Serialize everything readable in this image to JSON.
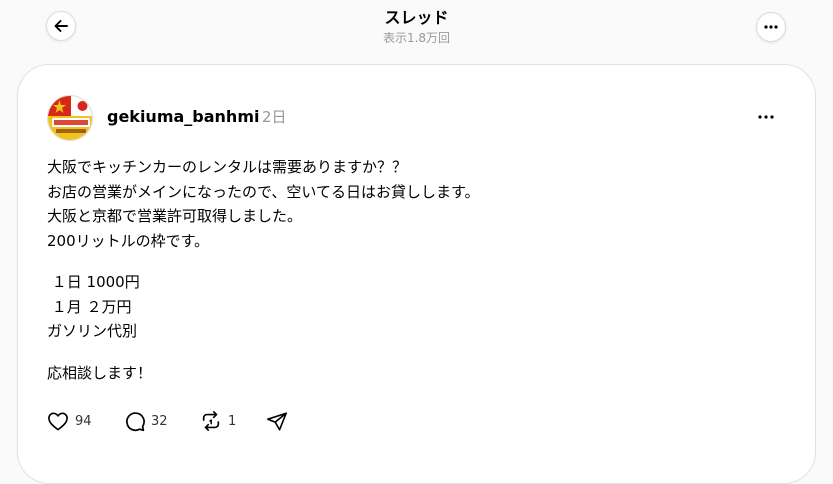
{
  "header": {
    "title": "スレッド",
    "views": "表示1.8万回"
  },
  "post": {
    "username": "gekiuma_banhmi",
    "time": "2日",
    "lines": [
      "大阪でキッチンカーのレンタルは需要ありますか？？",
      "お店の営業がメインになったので、空いてる日はお貸しします。",
      "大阪と京都で営業許可取得しました。",
      "200リットルの枠です。",
      "",
      " １日 1000円",
      " １月 ２万円",
      "ガソリン代別",
      "",
      "応相談します！"
    ],
    "likes": "94",
    "replies": "32",
    "reposts": "1"
  },
  "colors": {
    "background": "#fafafa",
    "card": "#ffffff",
    "muted": "#999999",
    "avatar_red": "#d62718",
    "avatar_yellow": "#f4c21d"
  }
}
